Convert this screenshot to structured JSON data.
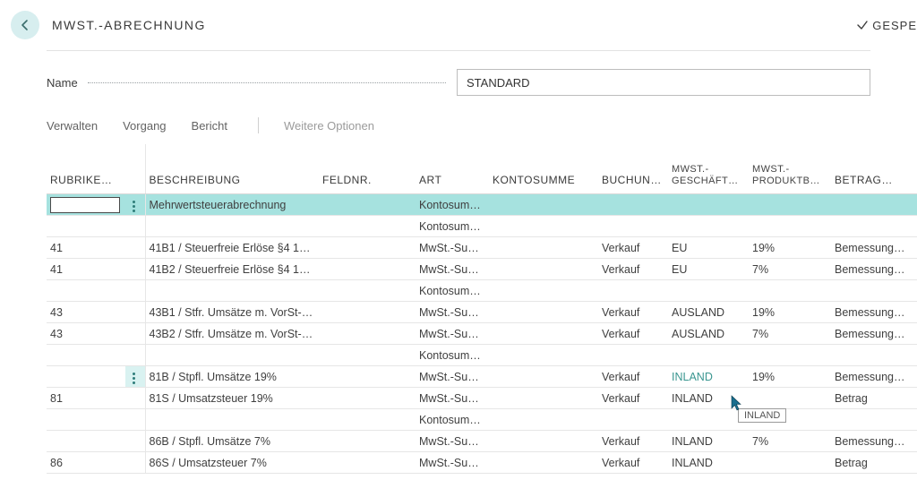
{
  "header": {
    "title": "MWST.-ABRECHNUNG",
    "saved_label": "GESPE"
  },
  "form": {
    "name_label": "Name",
    "name_value": "STANDARD"
  },
  "actions": {
    "manage": "Verwalten",
    "process": "Vorgang",
    "report": "Bericht",
    "more": "Weitere Optionen"
  },
  "columns": {
    "rubrik": "RUBRIKE…",
    "beschreibung": "BESCHREIBUNG",
    "feldnr": "FELDNR.",
    "art": "ART",
    "kontosumme": "KONTOSUMME",
    "buchung": "BUCHUN…",
    "mwst_gesch_top": "MWST.-",
    "mwst_gesch_bot": "GESCHÄFT…",
    "mwst_prod_top": "MWST.-",
    "mwst_prod_bot": "PRODUKTB…",
    "betrag": "BETRAG…"
  },
  "rows": [
    {
      "rubrik": "",
      "desc": "Mehrwertsteuerabrechnung",
      "feld": "",
      "art": "Kontosumme",
      "konto": "",
      "buch": "",
      "gesch": "",
      "prod": "",
      "betrag": "",
      "selected": true,
      "edit_rubrik": true,
      "show_menu": true
    },
    {
      "rubrik": "",
      "desc": "",
      "feld": "",
      "art": "Kontosumme",
      "konto": "",
      "buch": "",
      "gesch": "",
      "prod": "",
      "betrag": ""
    },
    {
      "rubrik": "41",
      "desc": "41B1 / Steuerfreie Erlöse §4 1b …",
      "feld": "",
      "art": "MwSt.-Sum…",
      "konto": "",
      "buch": "Verkauf",
      "gesch": "EU",
      "prod": "19%",
      "betrag": "Bemessung…"
    },
    {
      "rubrik": "41",
      "desc": "41B2 / Steuerfreie Erlöse §4 1b …",
      "feld": "",
      "art": "MwSt.-Sum…",
      "konto": "",
      "buch": "Verkauf",
      "gesch": "EU",
      "prod": "7%",
      "betrag": "Bemessung…"
    },
    {
      "rubrik": "",
      "desc": "",
      "feld": "",
      "art": "Kontosumme",
      "konto": "",
      "buch": "",
      "gesch": "",
      "prod": "",
      "betrag": ""
    },
    {
      "rubrik": "43",
      "desc": "43B1 / Stfr. Umsätze m. VorSt-…",
      "feld": "",
      "art": "MwSt.-Sum…",
      "konto": "",
      "buch": "Verkauf",
      "gesch": "AUSLAND",
      "prod": "19%",
      "betrag": "Bemessung…"
    },
    {
      "rubrik": "43",
      "desc": "43B2 / Stfr. Umsätze m. VorSt-…",
      "feld": "",
      "art": "MwSt.-Sum…",
      "konto": "",
      "buch": "Verkauf",
      "gesch": "AUSLAND",
      "prod": "7%",
      "betrag": "Bemessung…"
    },
    {
      "rubrik": "",
      "desc": "",
      "feld": "",
      "art": "Kontosumme",
      "konto": "",
      "buch": "",
      "gesch": "",
      "prod": "",
      "betrag": ""
    },
    {
      "rubrik": "",
      "desc": "81B / Stpfl. Umsätze 19%",
      "feld": "",
      "art": "MwSt.-Sum…",
      "konto": "",
      "buch": "Verkauf",
      "gesch": "INLAND",
      "prod": "19%",
      "betrag": "Bemessung…",
      "highlight_menu": true,
      "hover_gesch": true
    },
    {
      "rubrik": "81",
      "desc": "81S / Umsatzsteuer 19%",
      "feld": "",
      "art": "MwSt.-Sum…",
      "konto": "",
      "buch": "Verkauf",
      "gesch": "INLAND",
      "prod": "",
      "betrag": "Betrag"
    },
    {
      "rubrik": "",
      "desc": "",
      "feld": "",
      "art": "Kontosumme",
      "konto": "",
      "buch": "",
      "gesch": "",
      "prod": "",
      "betrag": ""
    },
    {
      "rubrik": "",
      "desc": "86B / Stpfl. Umsätze 7%",
      "feld": "",
      "art": "MwSt.-Sum…",
      "konto": "",
      "buch": "Verkauf",
      "gesch": "INLAND",
      "prod": "7%",
      "betrag": "Bemessung…"
    },
    {
      "rubrik": "86",
      "desc": "86S / Umsatzsteuer 7%",
      "feld": "",
      "art": "MwSt.-Sum…",
      "konto": "",
      "buch": "Verkauf",
      "gesch": "INLAND",
      "prod": "",
      "betrag": "Betrag"
    }
  ],
  "tooltip": "INLAND"
}
